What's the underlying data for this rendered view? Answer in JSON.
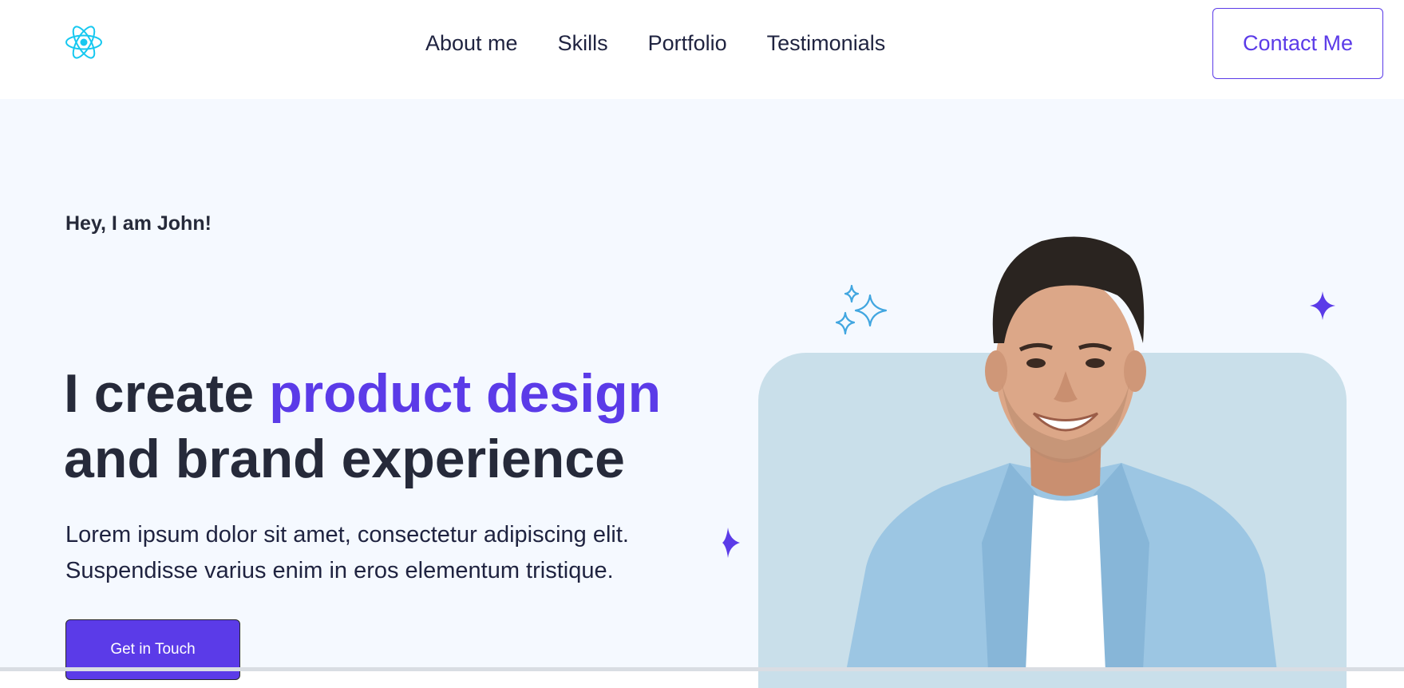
{
  "header": {
    "logo_icon": "react-atom-icon",
    "nav": [
      {
        "label": "About me"
      },
      {
        "label": "Skills"
      },
      {
        "label": "Portfolio"
      },
      {
        "label": "Testimonials"
      }
    ],
    "contact_label": "Contact Me"
  },
  "hero": {
    "greeting": "Hey, I am John!",
    "headline_part1": "I create ",
    "headline_accent": "product design",
    "headline_part2": "and brand experience",
    "description_line1": "Lorem ipsum dolor sit amet, consectetur adipiscing elit.",
    "description_line2": "Suspendisse varius enim in eros elementum tristique.",
    "cta_label": "Get in Touch"
  },
  "colors": {
    "accent": "#5b3be8",
    "logo": "#16c8f0",
    "text_dark": "#262a3a",
    "hero_bg": "#f5f9ff",
    "photo_bg": "#c9dfea",
    "sparkle_blue": "#41a6e0"
  }
}
